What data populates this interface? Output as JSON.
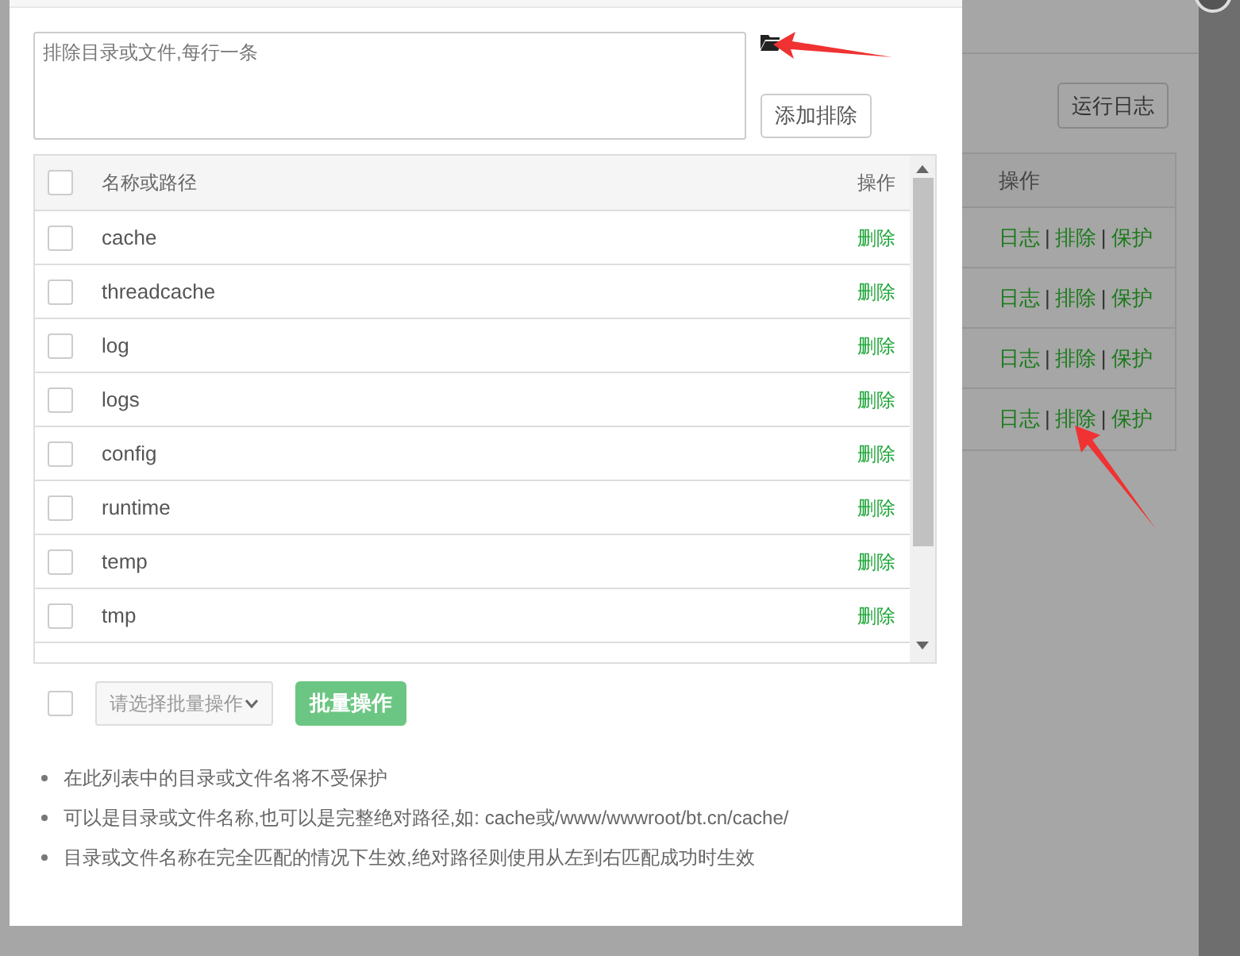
{
  "background": {
    "log_button": "运行日志",
    "table": {
      "columns": [
        "操作"
      ],
      "separator": "|",
      "rows": [
        {
          "links": [
            "日志",
            "排除",
            "保护"
          ]
        },
        {
          "links": [
            "日志",
            "排除",
            "保护"
          ]
        },
        {
          "links": [
            "日志",
            "排除",
            "保护"
          ]
        },
        {
          "links": [
            "日志",
            "排除",
            "保护"
          ]
        }
      ]
    }
  },
  "dialog": {
    "exclude_input": {
      "placeholder": "排除目录或文件,每行一条"
    },
    "add_button": "添加排除",
    "table": {
      "columns": [
        "名称或路径",
        "操作"
      ],
      "all_checked": false,
      "rows": [
        {
          "name": "cache",
          "action": "删除",
          "checked": false
        },
        {
          "name": "threadcache",
          "action": "删除",
          "checked": false
        },
        {
          "name": "log",
          "action": "删除",
          "checked": false
        },
        {
          "name": "logs",
          "action": "删除",
          "checked": false
        },
        {
          "name": "config",
          "action": "删除",
          "checked": false
        },
        {
          "name": "runtime",
          "action": "删除",
          "checked": false
        },
        {
          "name": "temp",
          "action": "删除",
          "checked": false
        },
        {
          "name": "tmp",
          "action": "删除",
          "checked": false
        }
      ]
    },
    "batch": {
      "checked": false,
      "select_placeholder": "请选择批量操作",
      "button": "批量操作"
    },
    "notes": [
      "在此列表中的目录或文件名将不受保护",
      "可以是目录或文件名称,也可以是完整绝对路径,如: cache或/www/wwwroot/bt.cn/cache/",
      "目录或文件名称在完全匹配的情况下生效,绝对路径则使用从左到右匹配成功时生效"
    ]
  }
}
